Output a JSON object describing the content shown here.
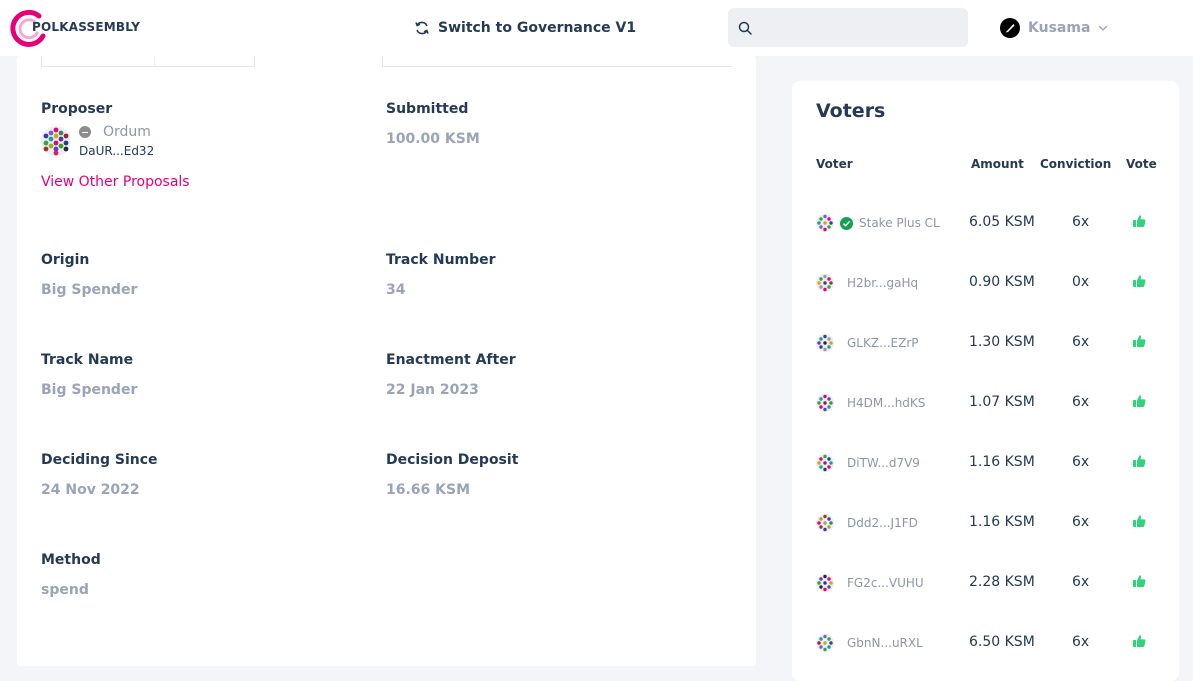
{
  "brand": {
    "logo_text": "POLKASSEMBLY",
    "accent_color": "#e5007a"
  },
  "navbar": {
    "switch_label": "Switch to Governance V1",
    "switch_icon": "refresh-icon",
    "search": {
      "placeholder": "",
      "value": "",
      "icon": "search-icon"
    },
    "network": {
      "label": "Kusama",
      "icon": "kusama-icon"
    }
  },
  "proposal": {
    "proposer": {
      "label": "Proposer",
      "name": "Ordum",
      "address": "DaUR...Ed32",
      "link_label": "View Other Proposals"
    },
    "submitted": {
      "label": "Submitted",
      "value": "100.00 KSM"
    },
    "origin": {
      "label": "Origin",
      "value": "Big Spender"
    },
    "track_number": {
      "label": "Track Number",
      "value": "34"
    },
    "track_name": {
      "label": "Track Name",
      "value": "Big Spender"
    },
    "enactment_after": {
      "label": "Enactment After",
      "value": "22 Jan 2023"
    },
    "deciding_since": {
      "label": "Deciding Since",
      "value": "24 Nov 2022"
    },
    "decision_deposit": {
      "label": "Decision Deposit",
      "value": "16.66 KSM"
    },
    "method": {
      "label": "Method",
      "value": "spend"
    }
  },
  "voters": {
    "title": "Voters",
    "columns": {
      "voter": "Voter",
      "amount": "Amount",
      "conviction": "Conviction",
      "vote": "Vote"
    },
    "vote_color": "#2ed47a",
    "rows": [
      {
        "name": "Stake Plus CL",
        "verified": true,
        "amount": "6.05 KSM",
        "conviction": "6x"
      },
      {
        "name": "H2br...gaHq",
        "verified": false,
        "amount": "0.90 KSM",
        "conviction": "0x"
      },
      {
        "name": "GLKZ...EZrP",
        "verified": false,
        "amount": "1.30 KSM",
        "conviction": "6x"
      },
      {
        "name": "H4DM...hdKS",
        "verified": false,
        "amount": "1.07 KSM",
        "conviction": "6x"
      },
      {
        "name": "DiTW...d7V9",
        "verified": false,
        "amount": "1.16 KSM",
        "conviction": "6x"
      },
      {
        "name": "Ddd2...J1FD",
        "verified": false,
        "amount": "1.16 KSM",
        "conviction": "6x"
      },
      {
        "name": "FG2c...VUHU",
        "verified": false,
        "amount": "2.28 KSM",
        "conviction": "6x"
      },
      {
        "name": "GbnN...uRXL",
        "verified": false,
        "amount": "6.50 KSM",
        "conviction": "6x"
      }
    ]
  }
}
